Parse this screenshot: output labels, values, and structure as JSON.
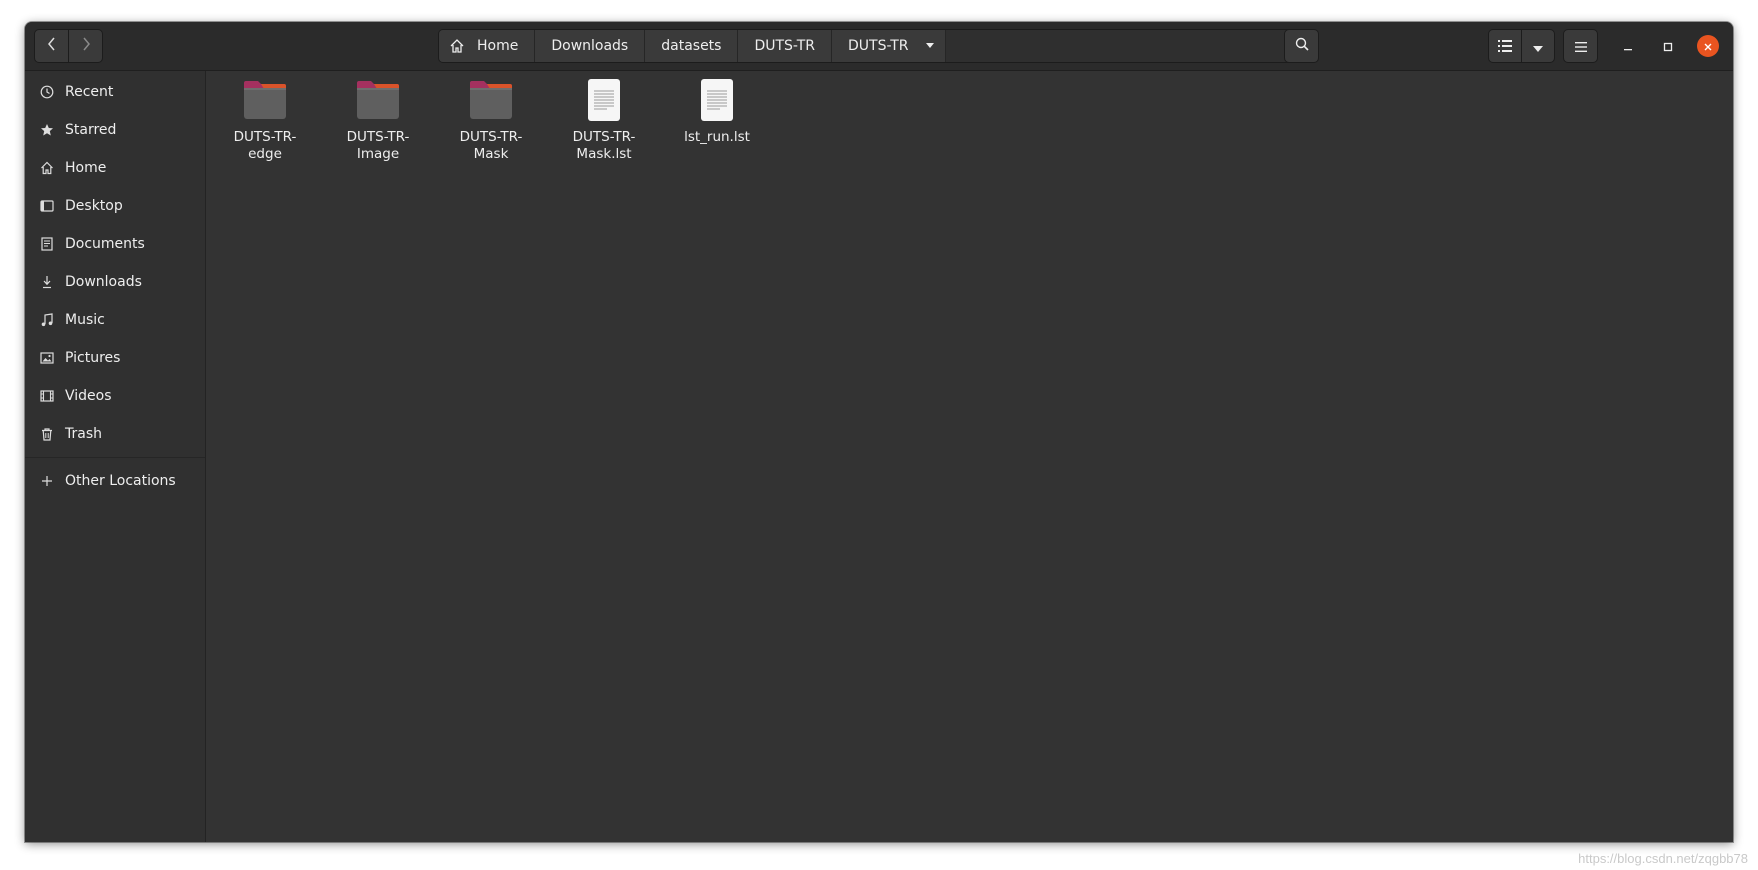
{
  "header": {
    "back_icon": "chevron-left-icon",
    "forward_icon": "chevron-right-icon",
    "breadcrumbs": [
      {
        "label": "Home",
        "icon": "home-icon"
      },
      {
        "label": "Downloads"
      },
      {
        "label": "datasets"
      },
      {
        "label": "DUTS-TR"
      },
      {
        "label": "DUTS-TR",
        "current": true
      }
    ],
    "search_icon": "search-icon",
    "view_icon": "list-view-icon",
    "view_menu_icon": "caret-down-icon",
    "menu_icon": "hamburger-menu-icon",
    "window_controls": [
      "minimize",
      "maximize",
      "close"
    ]
  },
  "sidebar": {
    "items": [
      {
        "label": "Recent",
        "icon": "clock-icon"
      },
      {
        "label": "Starred",
        "icon": "star-icon"
      },
      {
        "label": "Home",
        "icon": "home-icon"
      },
      {
        "label": "Desktop",
        "icon": "desktop-icon"
      },
      {
        "label": "Documents",
        "icon": "document-icon"
      },
      {
        "label": "Downloads",
        "icon": "download-icon"
      },
      {
        "label": "Music",
        "icon": "music-icon"
      },
      {
        "label": "Pictures",
        "icon": "picture-icon"
      },
      {
        "label": "Videos",
        "icon": "video-icon"
      },
      {
        "label": "Trash",
        "icon": "trash-icon"
      }
    ],
    "other_locations": {
      "label": "Other Locations",
      "icon": "plus-icon"
    }
  },
  "files": [
    {
      "name": "DUTS-TR-edge",
      "type": "folder",
      "line1": "DUTS-TR-",
      "line2": "edge"
    },
    {
      "name": "DUTS-TR-Image",
      "type": "folder",
      "line1": "DUTS-TR-",
      "line2": "Image"
    },
    {
      "name": "DUTS-TR-Mask",
      "type": "folder",
      "line1": "DUTS-TR-",
      "line2": "Mask"
    },
    {
      "name": "DUTS-TR-Mask.lst",
      "type": "text-file",
      "line1": "DUTS-TR-",
      "line2": "Mask.lst"
    },
    {
      "name": "lst_run.lst",
      "type": "text-file",
      "line1": "lst_run.lst",
      "line2": ""
    }
  ],
  "watermark": "https://blog.csdn.net/zqgbb78",
  "colors": {
    "accent_close": "#e95420",
    "folder_tab": "#a4305f",
    "folder_body": "#5f5f5f",
    "background": "#333333"
  }
}
